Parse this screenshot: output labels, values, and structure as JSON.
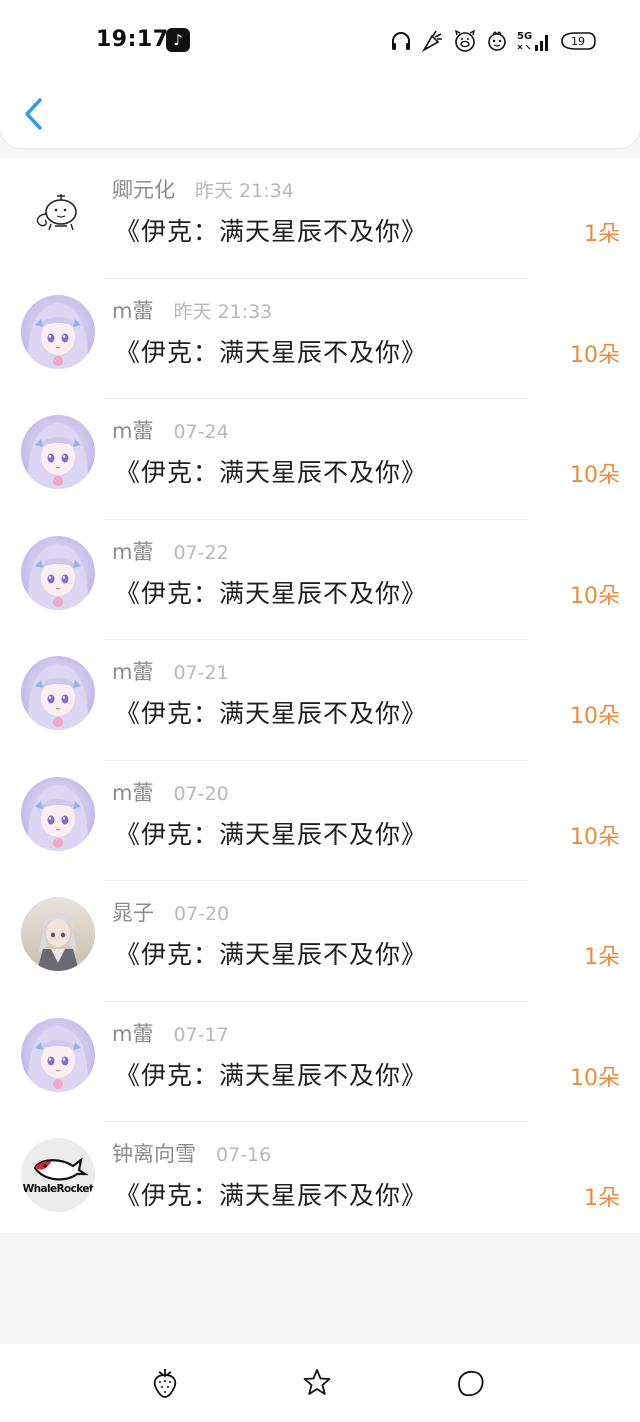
{
  "status_bar": {
    "time": "19:17",
    "network": "5G",
    "battery": "19"
  },
  "header": {
    "back_icon": "chevron-left-icon"
  },
  "colors": {
    "accent_blue": "#2f9ee8",
    "count_orange": "#ef8a3d",
    "name_gray": "#8c8c8c",
    "date_gray": "#b8b8b8"
  },
  "rows": [
    {
      "name": "卿元化",
      "date": "昨天 21:34",
      "gift": "《伊克：满天星辰不及你》",
      "count": "1朵",
      "avatar": "monkey-sketch"
    },
    {
      "name": "m蕾",
      "date": "昨天 21:33",
      "gift": "《伊克：满天星辰不及你》",
      "count": "10朵",
      "avatar": "anime-girl"
    },
    {
      "name": "m蕾",
      "date": "07-24",
      "gift": "《伊克：满天星辰不及你》",
      "count": "10朵",
      "avatar": "anime-girl"
    },
    {
      "name": "m蕾",
      "date": "07-22",
      "gift": "《伊克：满天星辰不及你》",
      "count": "10朵",
      "avatar": "anime-girl"
    },
    {
      "name": "m蕾",
      "date": "07-21",
      "gift": "《伊克：满天星辰不及你》",
      "count": "10朵",
      "avatar": "anime-girl"
    },
    {
      "name": "m蕾",
      "date": "07-20",
      "gift": "《伊克：满天星辰不及你》",
      "count": "10朵",
      "avatar": "anime-girl"
    },
    {
      "name": "晁子",
      "date": "07-20",
      "gift": "《伊克：满天星辰不及你》",
      "count": "1朵",
      "avatar": "anime-boy"
    },
    {
      "name": "m蕾",
      "date": "07-17",
      "gift": "《伊克：满天星辰不及你》",
      "count": "10朵",
      "avatar": "anime-girl"
    },
    {
      "name": "钟离向雪",
      "date": "07-16",
      "gift": "《伊克：满天星辰不及你》",
      "count": "1朵",
      "avatar": "whalerocket-logo"
    }
  ],
  "bottom_nav": {
    "items": [
      "strawberry-icon",
      "star-icon",
      "bubble-icon"
    ]
  }
}
